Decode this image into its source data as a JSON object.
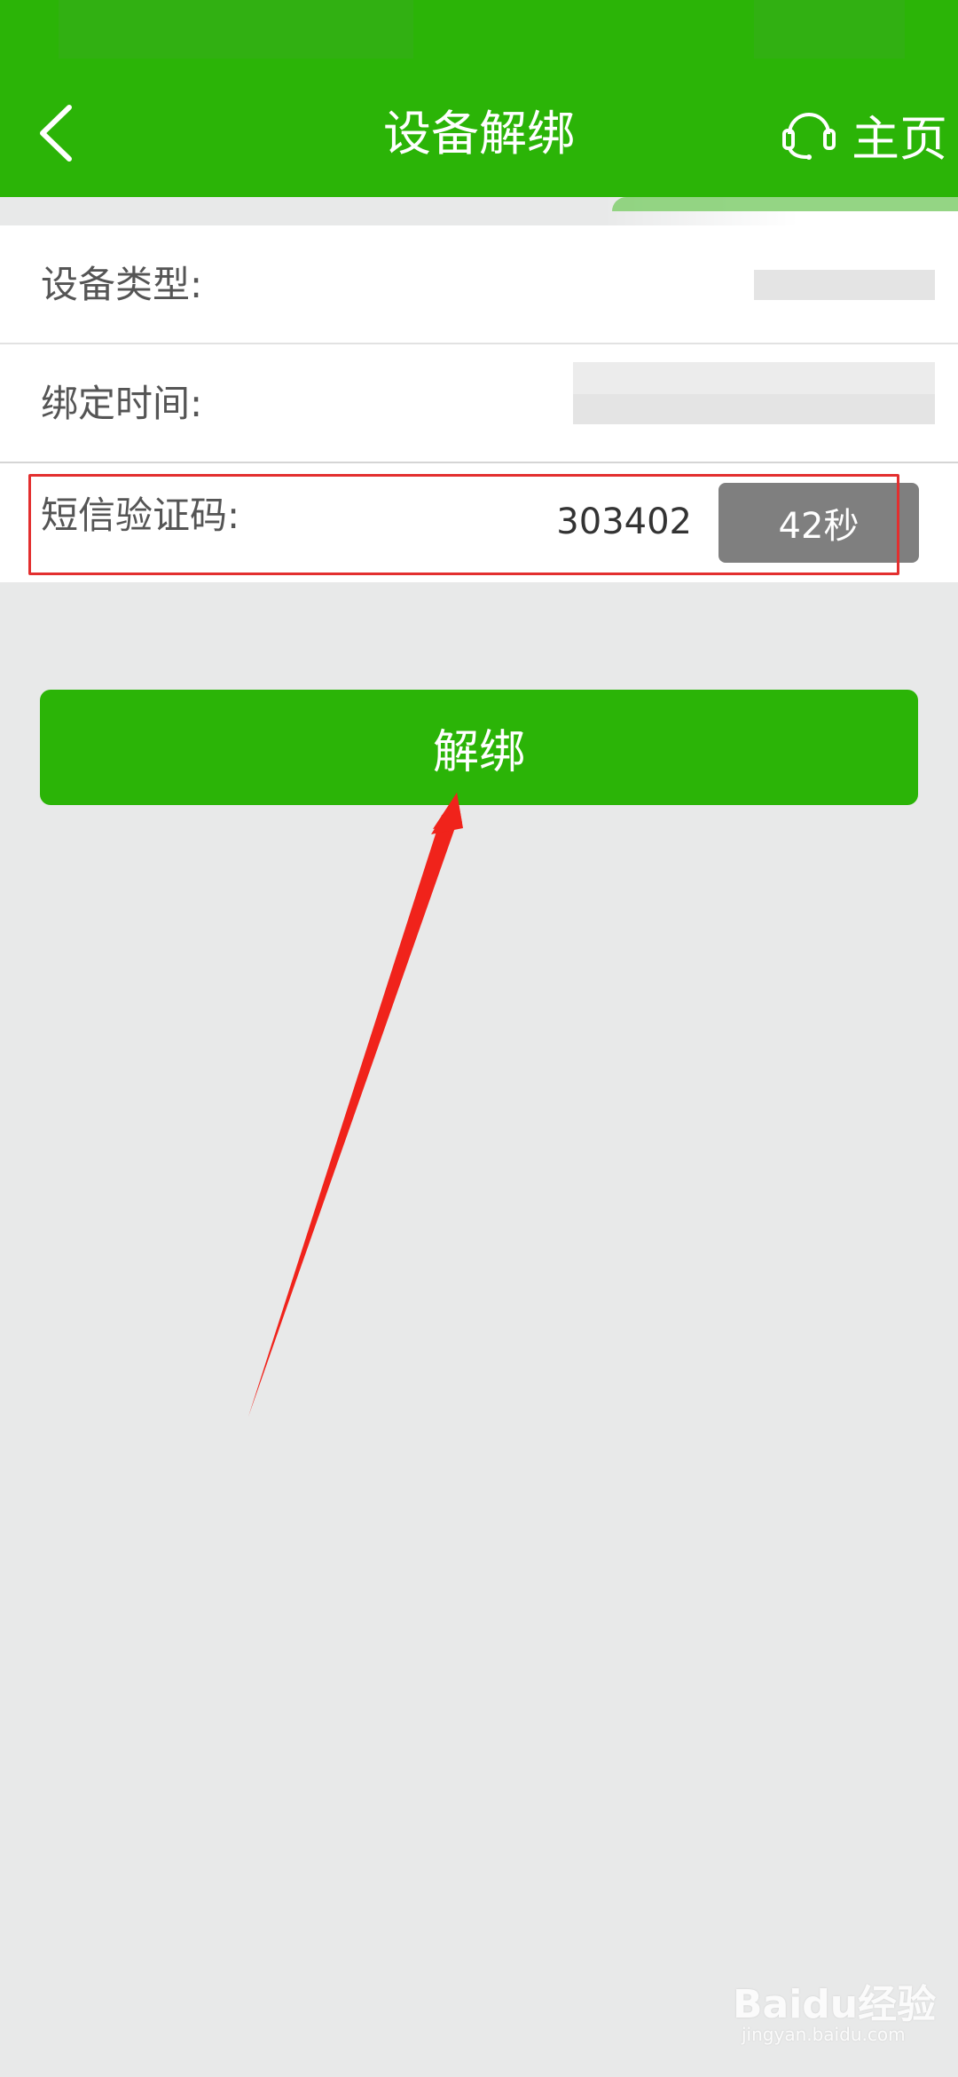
{
  "header": {
    "title": "设备解绑",
    "home_label": "主页",
    "back_icon": "chevron-left-icon",
    "home_icon": "headset-icon"
  },
  "form": {
    "device_type_label": "设备类型:",
    "bind_time_label": "绑定时间:",
    "sms_code_label": "短信验证码:",
    "sms_code_value": "303402",
    "countdown_label": "42秒"
  },
  "actions": {
    "unbind_label": "解绑"
  },
  "watermark": {
    "brand": "Baidu经验",
    "site": "jingyan.baidu.com"
  },
  "colors": {
    "brand_green": "#2bb407",
    "countdown_gray": "#7f7f7f",
    "annotation_red": "#e32f2f"
  }
}
